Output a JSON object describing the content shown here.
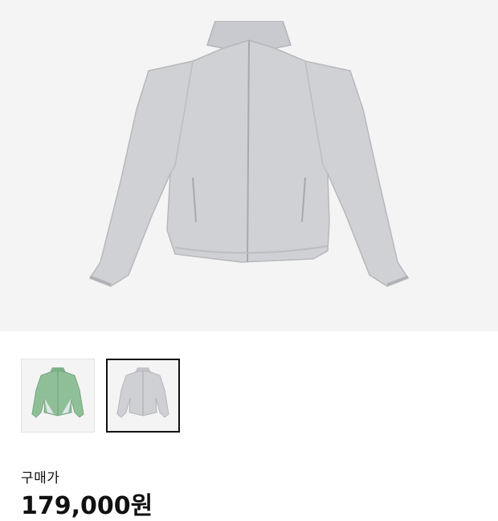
{
  "product": {
    "main_image": {
      "icon": "jacket-grey-image",
      "color": "#cfd0d4"
    },
    "thumbnails": [
      {
        "icon": "jacket-green-thumbnail",
        "color": "#8fbf97",
        "selected": false
      },
      {
        "icon": "jacket-grey-thumbnail",
        "color": "#cfd0d4",
        "selected": true
      }
    ]
  },
  "purchase": {
    "label": "구매가",
    "price": "179,000원"
  }
}
